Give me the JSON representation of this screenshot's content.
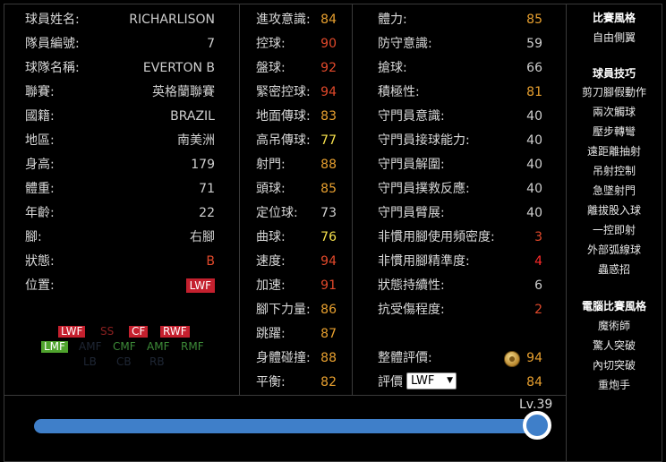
{
  "colors": {
    "orange": "#e8a02f",
    "yellow": "#f0c93a",
    "bright_yellow": "#f5e04c",
    "red_val": "#e2492b",
    "bright_red": "#ff2a2a",
    "gray_val": "#cfcfcf",
    "slider": "#3f7fc9"
  },
  "player": {
    "name_label": "球員姓名:",
    "name": "RICHARLISON",
    "number_label": "隊員編號:",
    "number": "7",
    "club_label": "球隊名稱:",
    "club": "EVERTON B",
    "league_label": "聯賽:",
    "league": "英格蘭聯賽",
    "nationality_label": "國籍:",
    "nationality": "BRAZIL",
    "region_label": "地區:",
    "region": "南美洲",
    "height_label": "身高:",
    "height": "179",
    "weight_label": "體重:",
    "weight": "71",
    "age_label": "年齡:",
    "age": "22",
    "foot_label": "腳:",
    "foot": "右腳",
    "condition_label": "狀態:",
    "condition": "B",
    "position_label": "位置:",
    "position": "LWF"
  },
  "position_map": {
    "lwf": "LWF",
    "ss": "SS",
    "cf": "CF",
    "rwf": "RWF",
    "lmf": "LMF",
    "amf_dim": "AMF",
    "cmf": "CMF",
    "amf": "AMF",
    "rmf": "RMF",
    "lb": "LB",
    "cb": "CB",
    "rb": "RB"
  },
  "stats_mid": [
    {
      "label": "進攻意識:",
      "value": "84",
      "color": "#e8a02f"
    },
    {
      "label": "控球:",
      "value": "90",
      "color": "#e2492b"
    },
    {
      "label": "盤球:",
      "value": "92",
      "color": "#e2492b"
    },
    {
      "label": "緊密控球:",
      "value": "94",
      "color": "#e2492b"
    },
    {
      "label": "地面傳球:",
      "value": "83",
      "color": "#e8a02f"
    },
    {
      "label": "高吊傳球:",
      "value": "77",
      "color": "#f5e04c"
    },
    {
      "label": "射門:",
      "value": "88",
      "color": "#e8a02f"
    },
    {
      "label": "頭球:",
      "value": "85",
      "color": "#e8a02f"
    },
    {
      "label": "定位球:",
      "value": "73",
      "color": "#cfcfcf"
    },
    {
      "label": "曲球:",
      "value": "76",
      "color": "#f5e04c"
    },
    {
      "label": "速度:",
      "value": "94",
      "color": "#e2492b"
    },
    {
      "label": "加速:",
      "value": "91",
      "color": "#e2492b"
    },
    {
      "label": "腳下力量:",
      "value": "86",
      "color": "#e8a02f"
    },
    {
      "label": "跳躍:",
      "value": "87",
      "color": "#e8a02f"
    },
    {
      "label": "身體碰撞:",
      "value": "88",
      "color": "#e8a02f"
    },
    {
      "label": "平衡:",
      "value": "82",
      "color": "#e8a02f"
    }
  ],
  "stats_right": [
    {
      "label": "體力:",
      "value": "85",
      "color": "#e8a02f"
    },
    {
      "label": "防守意識:",
      "value": "59",
      "color": "#cfcfcf"
    },
    {
      "label": "搶球:",
      "value": "66",
      "color": "#cfcfcf"
    },
    {
      "label": "積極性:",
      "value": "81",
      "color": "#e8a02f"
    },
    {
      "label": "守門員意識:",
      "value": "40",
      "color": "#cfcfcf"
    },
    {
      "label": "守門員接球能力:",
      "value": "40",
      "color": "#cfcfcf"
    },
    {
      "label": "守門員解圍:",
      "value": "40",
      "color": "#cfcfcf"
    },
    {
      "label": "守門員撲救反應:",
      "value": "40",
      "color": "#cfcfcf"
    },
    {
      "label": "守門員臂展:",
      "value": "40",
      "color": "#cfcfcf"
    },
    {
      "label": "非慣用腳使用頻密度:",
      "value": "3",
      "color": "#e2492b"
    },
    {
      "label": "非慣用腳精準度:",
      "value": "4",
      "color": "#ff2a2a"
    },
    {
      "label": "狀態持續性:",
      "value": "6",
      "color": "#cfcfcf"
    },
    {
      "label": "抗受傷程度:",
      "value": "2",
      "color": "#e2492b"
    }
  ],
  "overall": {
    "label": "整體評價:",
    "value": "94",
    "icon": "coin-icon"
  },
  "rating": {
    "label": "評價",
    "selected": "LWF",
    "value": "84"
  },
  "sidebar": {
    "match_style_title": "比賽風格",
    "match_style": [
      "自由側翼"
    ],
    "skills_title": "球員技巧",
    "skills": [
      "剪刀腳假動作",
      "兩次觸球",
      "壓步轉彎",
      "遠距離抽射",
      "吊射控制",
      "急墜射門",
      "離拔股入球",
      "一控即射",
      "外部弧線球",
      "蟲惑招"
    ],
    "ai_style_title": "電腦比賽風格",
    "ai_style": [
      "魔術師",
      "驚人突破",
      "內切突破",
      "重炮手"
    ]
  },
  "level": {
    "label": "Lv.39",
    "fraction": 1.0
  }
}
